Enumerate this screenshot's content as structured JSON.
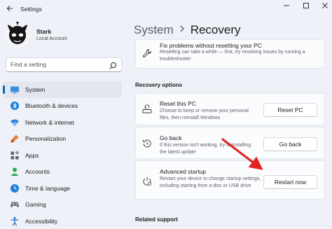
{
  "window": {
    "app_title": "Settings",
    "back_icon": "back-arrow-icon",
    "controls": [
      "minimize-icon",
      "maximize-icon",
      "close-icon"
    ]
  },
  "user": {
    "name": "Stark",
    "account_type": "Local Account"
  },
  "search": {
    "placeholder": "Find a setting",
    "icon": "search-icon"
  },
  "sidebar": {
    "items": [
      {
        "label": "System",
        "icon": "system-display-icon",
        "active": true
      },
      {
        "label": "Bluetooth & devices",
        "icon": "bluetooth-icon",
        "active": false
      },
      {
        "label": "Network & internet",
        "icon": "wifi-icon",
        "active": false
      },
      {
        "label": "Personalization",
        "icon": "paintbrush-icon",
        "active": false
      },
      {
        "label": "Apps",
        "icon": "apps-grid-icon",
        "active": false
      },
      {
        "label": "Accounts",
        "icon": "person-icon",
        "active": false
      },
      {
        "label": "Time & language",
        "icon": "clock-globe-icon",
        "active": false
      },
      {
        "label": "Gaming",
        "icon": "gamepad-icon",
        "active": false
      },
      {
        "label": "Accessibility",
        "icon": "accessibility-icon",
        "active": false
      }
    ]
  },
  "breadcrumb": {
    "parent": "System",
    "current": "Recovery"
  },
  "fix_card": {
    "title": "Fix problems without resetting your PC",
    "description": "Resetting can take a while — first, try resolving issues by running a troubleshooter",
    "icon": "wrench-icon"
  },
  "recovery_options": {
    "heading": "Recovery options",
    "items": [
      {
        "title": "Reset this PC",
        "description": "Choose to keep or remove your personal files, then reinstall Windows",
        "button": "Reset PC",
        "icon": "reset-pc-icon"
      },
      {
        "title": "Go back",
        "description": "If this version isn't working, try uninstalling the latest update",
        "button": "Go back",
        "icon": "history-icon"
      },
      {
        "title": "Advanced startup",
        "description": "Restart your device to change startup settings, including starting from a disc or USB drive",
        "button": "Restart now",
        "icon": "advanced-startup-icon"
      }
    ]
  },
  "related": {
    "heading": "Related support"
  },
  "colors": {
    "accent": "#0067c0",
    "annotation_arrow": "#e02424",
    "background": "#eef1f7",
    "card": "#fbfcfe"
  }
}
